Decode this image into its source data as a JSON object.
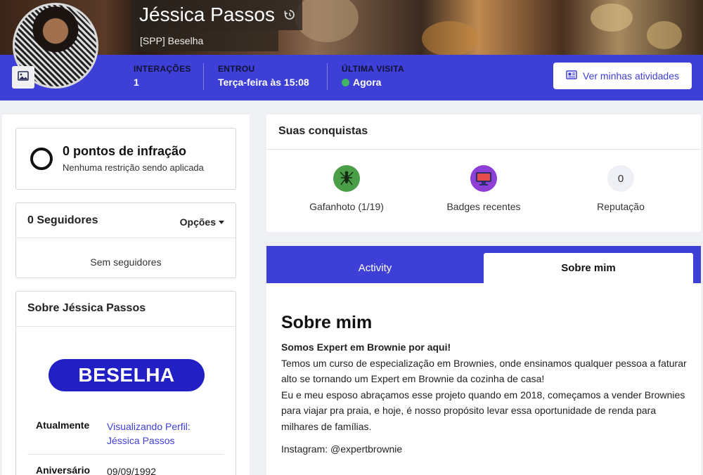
{
  "profile": {
    "name": "Jéssica Passos",
    "user_title": "[SPP] Beselha"
  },
  "stats": {
    "interactions_label": "INTERAÇÕES",
    "interactions_value": "1",
    "joined_label": "ENTROU",
    "joined_value": "Terça-feira às 15:08",
    "last_visit_label": "ÚLTIMA VISITA",
    "last_visit_value": "Agora"
  },
  "header_button": {
    "label": "Ver minhas atividades",
    "icon": "activity-feed-icon"
  },
  "infraction": {
    "title": "0 pontos de infração",
    "subtitle": "Nenhuma restrição sendo aplicada"
  },
  "followers": {
    "title": "0 Seguidores",
    "options_label": "Opções",
    "empty_text": "Sem seguidores"
  },
  "about_sidebar": {
    "title": "Sobre Jéssica Passos",
    "logo_text": "BESELHA",
    "rows": [
      {
        "key": "Atualmente",
        "value": "Visualizando Perfil: Jéssica Passos"
      },
      {
        "key": "Aniversário",
        "value": "09/09/1992"
      }
    ]
  },
  "achievements": {
    "title": "Suas conquistas",
    "items": [
      {
        "label": "Gafanhoto (1/19)",
        "icon": "grasshopper-icon",
        "color": "#4a9e48"
      },
      {
        "label": "Badges recentes",
        "icon": "monitor-badge-icon",
        "color": "#8d3fd6"
      },
      {
        "label": "Reputação",
        "value": "0",
        "color": "#eef0f6"
      }
    ]
  },
  "tabs": [
    {
      "label": "Activity",
      "active": false
    },
    {
      "label": "Sobre mim",
      "active": true
    }
  ],
  "about_me": {
    "heading": "Sobre mim",
    "lead": "Somos Expert em Brownie por aqui!",
    "paragraph1": "Temos um curso de especialização em Brownies, onde ensinamos qualquer pessoa a faturar alto se tornando um Expert em Brownie da cozinha de casa!",
    "paragraph2": "Eu e meu esposo abraçamos esse projeto quando em 2018, começamos a vender Brownies para viajar pra praia, e hoje, é nosso propósito levar essa oportunidade de renda para milhares de famílias.",
    "instagram": "Instagram: @expertbrownie"
  },
  "colors": {
    "brand": "#3d3fd6",
    "online": "#41b565",
    "logo_bg": "#2220c4"
  }
}
